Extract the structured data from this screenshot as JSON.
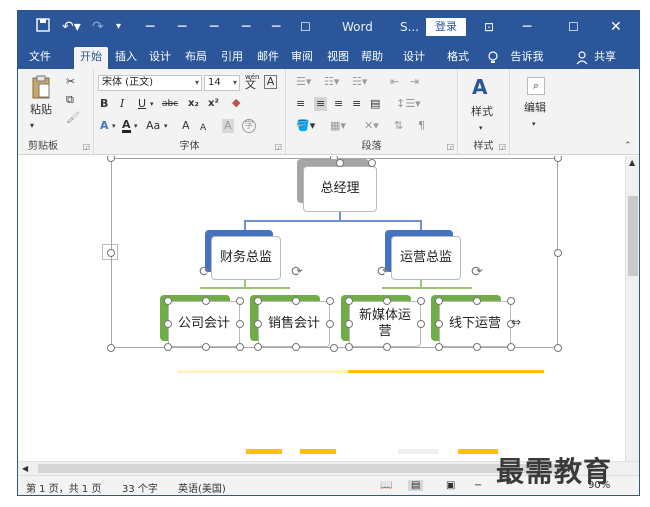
{
  "title_bar": {
    "app_name": "Word",
    "doc_abbrev": "S...",
    "login_label": "登录"
  },
  "tabs": [
    {
      "label": "文件"
    },
    {
      "label": "开始"
    },
    {
      "label": "插入"
    },
    {
      "label": "设计"
    },
    {
      "label": "布局"
    },
    {
      "label": "引用"
    },
    {
      "label": "邮件"
    },
    {
      "label": "审阅"
    },
    {
      "label": "视图"
    },
    {
      "label": "帮助"
    },
    {
      "label": "设计"
    },
    {
      "label": "格式"
    },
    {
      "label": "告诉我"
    },
    {
      "label": "共享"
    }
  ],
  "ribbon": {
    "clipboard": {
      "paste_label": "粘贴",
      "group_label": "剪贴板"
    },
    "font": {
      "font_name": "宋体 (正文)",
      "font_size": "14",
      "wen_label": "wén",
      "wen_char": "文",
      "frame_char": "A",
      "bold": "B",
      "italic": "I",
      "underline": "U",
      "strike": "abc",
      "subscript": "x₂",
      "superscript": "x²",
      "text_effect": "A",
      "highlight": "ab",
      "font_color": "A",
      "case": "Aa",
      "grow": "A",
      "shrink": "A",
      "char_shade": "A",
      "enclose": "字",
      "group_label": "字体"
    },
    "paragraph": {
      "group_label": "段落"
    },
    "styles": {
      "label": "样式",
      "group_label": "样式"
    },
    "editing": {
      "label": "编辑"
    }
  },
  "org_chart": {
    "top": "总经理",
    "level2": [
      "财务总监",
      "运营总监"
    ],
    "level3": [
      "公司会计",
      "销售会计",
      "新媒体运营",
      "线下运营"
    ]
  },
  "status_bar": {
    "page": "第 1 页，共 1 页",
    "words": "33 个字",
    "language": "英语(美国)",
    "zoom": "90%"
  },
  "watermark": "最需教育",
  "colors": {
    "accent": "#2b579a",
    "level2": "#4472c4",
    "level3": "#70ad47",
    "top_shadow": "#a5a5a5",
    "band": "#ffc000"
  }
}
